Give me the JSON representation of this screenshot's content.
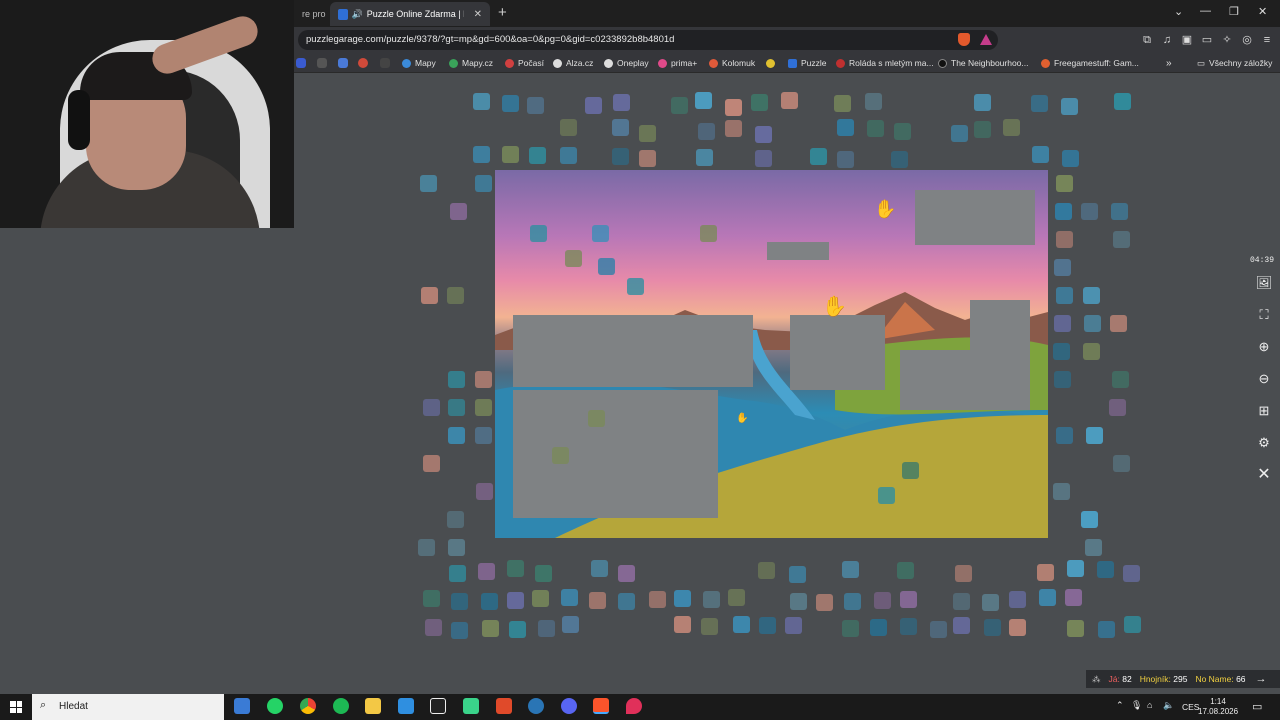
{
  "browser": {
    "tab_prev_partial": "re pro",
    "tab_active_title": "Puzzle Online Zdarma | Puzzle",
    "url": "puzzlegarage.com/puzzle/9378/?gt=mp&gd=600&oa=0&pg=0&gid=c0233892b8b4801d",
    "bookmarks": [
      "Mapy",
      "Mapy.cz",
      "Počasí",
      "Alza.cz",
      "Oneplay",
      "prima+",
      "Kolomuk",
      "Puzzle",
      "Roláda s mletým ma...",
      "The Neighbourhoo...",
      "Freegamestuff: Gam..."
    ],
    "bookmarks_folder": "Všechny záložky"
  },
  "game": {
    "timer": "04:39",
    "tools": [
      "image-icon",
      "fullscreen-icon",
      "zoom-in-icon",
      "zoom-out-icon",
      "grid-icon",
      "settings-icon",
      "close-icon"
    ]
  },
  "scoreboard": {
    "players": [
      {
        "name": "Já:",
        "score": "82",
        "color": "#f06060"
      },
      {
        "name": "Hnojník:",
        "score": "295",
        "color": "#f0d040"
      },
      {
        "name": "No Name:",
        "score": "66",
        "color": "#f0d040"
      }
    ]
  },
  "taskbar": {
    "search_placeholder": "Hledat",
    "language": "CES",
    "time": "1:14",
    "date": "17.08.2026"
  }
}
